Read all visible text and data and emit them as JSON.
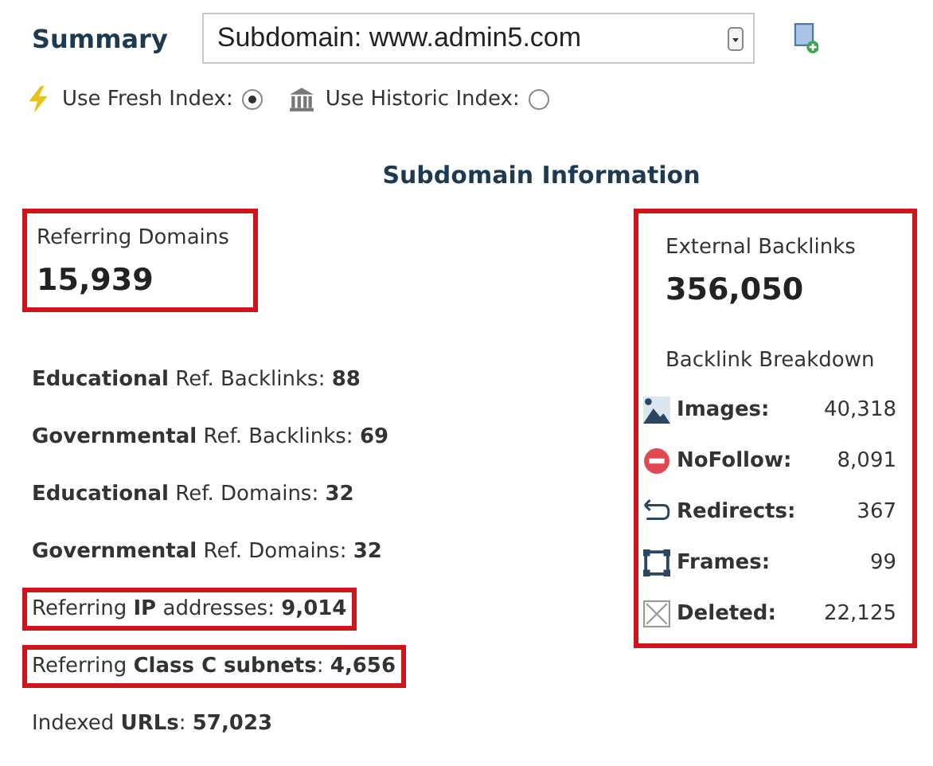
{
  "header": {
    "title": "Summary",
    "select_value": "Subdomain: www.admin5.com"
  },
  "index_options": [
    {
      "kind": "fresh",
      "label": "Use Fresh Index:",
      "selected": true
    },
    {
      "kind": "historic",
      "label": "Use Historic Index:",
      "selected": false
    }
  ],
  "section_title": "Subdomain Information",
  "referring_domains": {
    "label": "Referring Domains",
    "value": "15,939",
    "highlighted": true
  },
  "stats": [
    {
      "text": "**Educational** Ref. Backlinks: **88**",
      "highlighted": false
    },
    {
      "text": "**Governmental** Ref. Backlinks: **69**",
      "highlighted": false
    },
    {
      "text": "**Educational** Ref. Domains: **32**",
      "highlighted": false
    },
    {
      "text": "**Governmental** Ref. Domains: **32**",
      "highlighted": false
    },
    {
      "text": "Referring **IP** addresses: **9,014**",
      "highlighted": true
    },
    {
      "text": "Referring **Class C subnets**: **4,656**",
      "highlighted": true
    },
    {
      "text": "Indexed **URLs**: **57,023**",
      "highlighted": false
    }
  ],
  "external_backlinks": {
    "label": "External Backlinks",
    "value": "356,050",
    "breakdown_title": "Backlink Breakdown",
    "highlighted": true,
    "breakdown": [
      {
        "kind": "images",
        "label": "Images:",
        "value": "40,318"
      },
      {
        "kind": "nofollow",
        "label": "NoFollow:",
        "value": "8,091"
      },
      {
        "kind": "redirects",
        "label": "Redirects:",
        "value": "367"
      },
      {
        "kind": "frames",
        "label": "Frames:",
        "value": "99"
      },
      {
        "kind": "deleted",
        "label": "Deleted:",
        "value": "22,125"
      }
    ]
  }
}
